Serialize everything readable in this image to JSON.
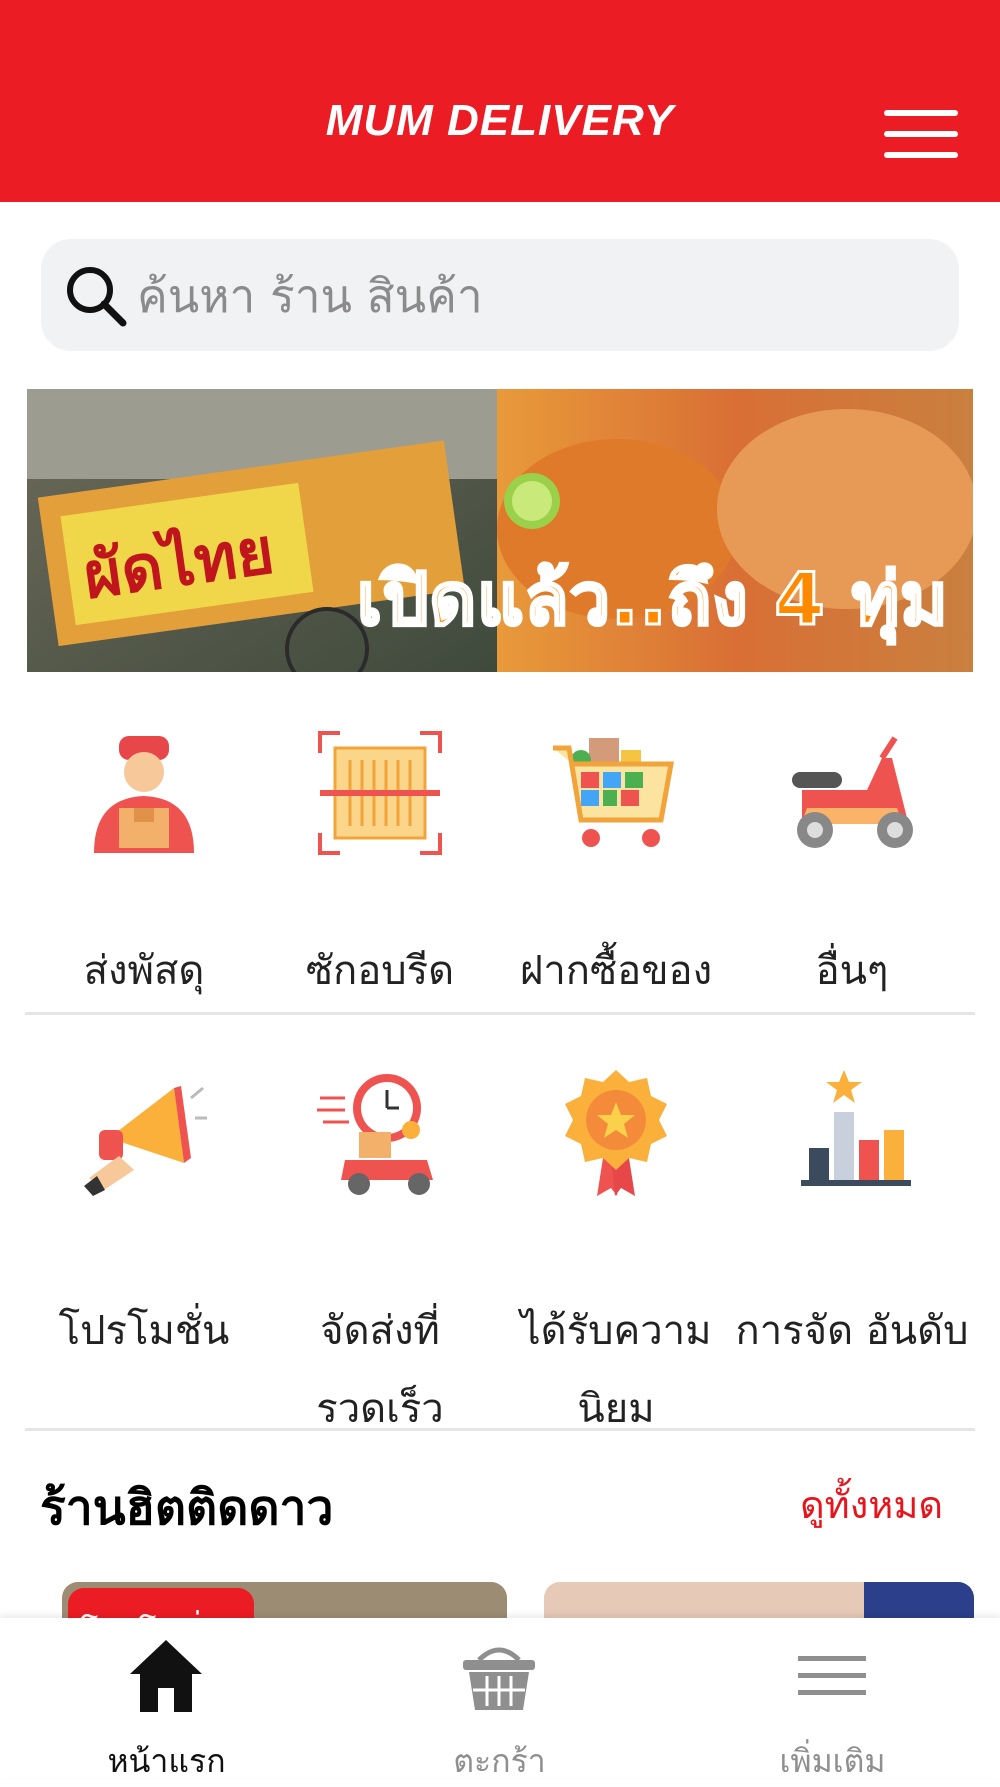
{
  "header": {
    "brand": "MUM DELIVERY",
    "menu_icon": "hamburger-icon",
    "color": "#ec1c24"
  },
  "search": {
    "placeholder": "ค้นหา ร้าน สินค้า",
    "icon": "search-icon"
  },
  "banner": {
    "text": "เปิดแล้ว..ถึง 4 ทุ่ม"
  },
  "services_row1": [
    {
      "label": "ส่งพัสดุ",
      "icon": "courier-icon"
    },
    {
      "label": "ซักอบรีด",
      "icon": "laundry-icon"
    },
    {
      "label": "ฝากซื้อของ",
      "icon": "shopping-cart-icon"
    },
    {
      "label": "อื่นๆ",
      "icon": "scooter-icon"
    }
  ],
  "services_row2": [
    {
      "label": "โปรโมชั่น",
      "icon": "megaphone-icon"
    },
    {
      "label": "จัดส่งที่ รวดเร็ว",
      "icon": "fast-delivery-icon"
    },
    {
      "label": "ได้รับความ นิยม",
      "icon": "award-icon"
    },
    {
      "label": "การจัด อันดับ",
      "icon": "ranking-chart-icon"
    }
  ],
  "popular": {
    "title": "ร้านฮิตติดดาว",
    "see_all": "ดูทั้งหมด",
    "badge": "โปรโมชั่น"
  },
  "bottom_nav": [
    {
      "label": "หน้าแรก",
      "icon": "home-icon",
      "active": true
    },
    {
      "label": "ตะกร้า",
      "icon": "basket-icon",
      "active": false
    },
    {
      "label": "เพิ่มเติม",
      "icon": "menu-icon",
      "active": false
    }
  ],
  "colors": {
    "accent": "#ec1c24",
    "active_nav": "#111111",
    "inactive_nav": "#8f8f8f"
  }
}
